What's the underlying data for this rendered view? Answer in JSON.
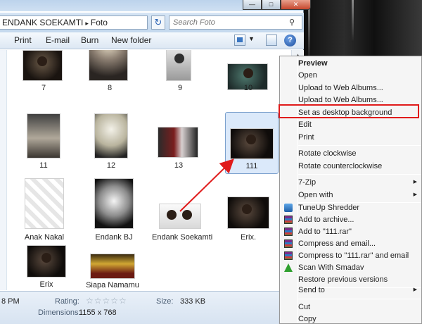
{
  "address": {
    "path": [
      "ENDANK SOEKAMTI",
      "Foto"
    ],
    "separator": "▸",
    "search_placeholder": "Search Foto"
  },
  "toolbar": {
    "print": "Print",
    "email": "E-mail",
    "burn": "Burn",
    "new_folder": "New folder",
    "help": "?"
  },
  "files": [
    {
      "label": "7"
    },
    {
      "label": "8"
    },
    {
      "label": "9"
    },
    {
      "label": "10"
    },
    {
      "label": "11"
    },
    {
      "label": "12"
    },
    {
      "label": "13"
    },
    {
      "label": "111"
    },
    {
      "label": "Anak Nakal"
    },
    {
      "label": "Endank BJ"
    },
    {
      "label": "Endank Soekamti"
    },
    {
      "label": "Erix."
    },
    {
      "label": "Erix"
    },
    {
      "label": "Siapa Namamu"
    }
  ],
  "details": {
    "time_fragment": "8 PM",
    "rating_label": "Rating:",
    "stars": "☆☆☆☆☆",
    "size_label": "Size:",
    "size_value": "333 KB",
    "dimensions_label": "Dimensions:",
    "dimensions_value": "1155 x 768"
  },
  "context_menu": {
    "items": [
      {
        "label": "Preview",
        "bold": true
      },
      {
        "label": "Open"
      },
      {
        "label": "Upload to Web Albums..."
      },
      {
        "label": "Upload to Web Albums..."
      },
      {
        "label": "Set as desktop background"
      },
      {
        "label": "Edit"
      },
      {
        "label": "Print"
      },
      {
        "label": "Rotate clockwise"
      },
      {
        "label": "Rotate counterclockwise"
      },
      {
        "label": "7-Zip"
      },
      {
        "label": "Open with"
      },
      {
        "label": "TuneUp Shredder"
      },
      {
        "label": "Add to archive..."
      },
      {
        "label": "Add to \"111.rar\""
      },
      {
        "label": "Compress and email..."
      },
      {
        "label": "Compress to \"111.rar\" and email"
      },
      {
        "label": "Scan With Smadav"
      },
      {
        "label": "Restore previous versions"
      },
      {
        "label": "Send to"
      },
      {
        "label": "Cut"
      },
      {
        "label": "Copy"
      }
    ]
  },
  "caption": {
    "minimize": "—",
    "maximize": "□",
    "close": "✕"
  },
  "colors": {
    "highlight": "#e01b1b",
    "selection": "#dbe9fa"
  }
}
